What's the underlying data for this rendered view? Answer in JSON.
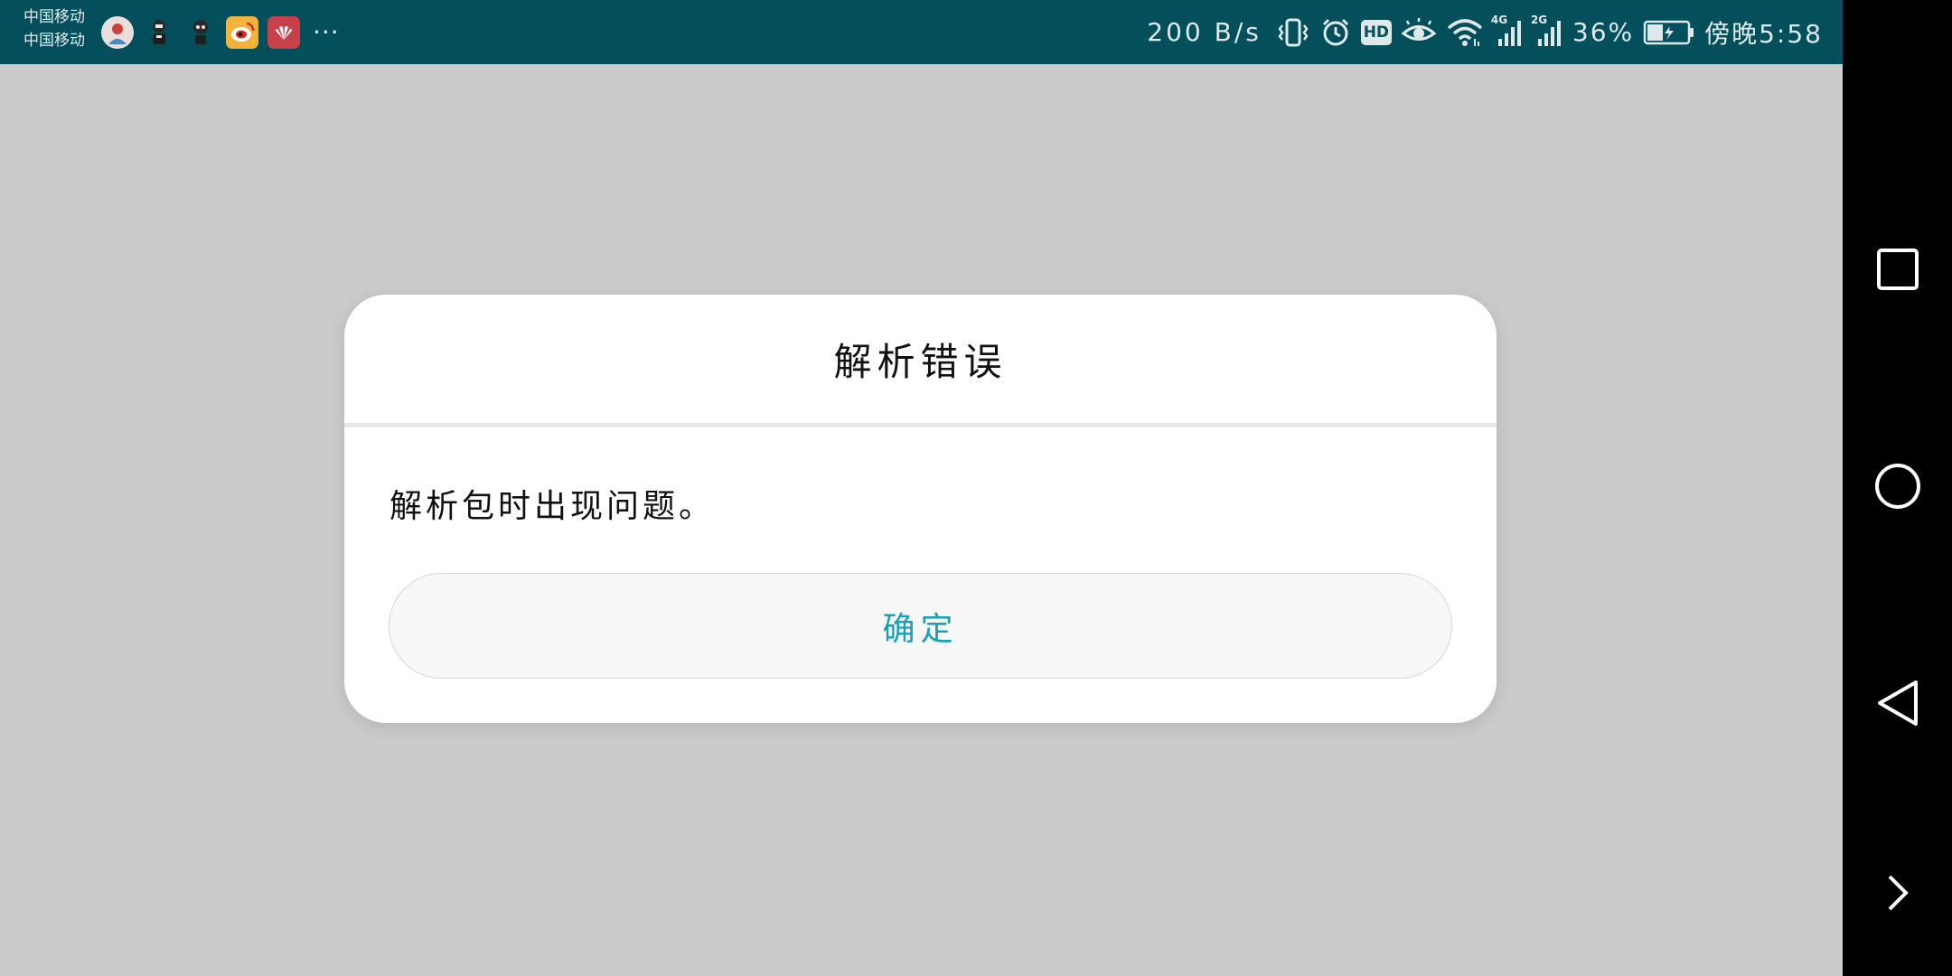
{
  "status_bar": {
    "carrier_1": "中国移动",
    "carrier_2": "中国移动",
    "more": "···",
    "network_speed": "200 B/s",
    "signal_1_type": "4G",
    "signal_2_type": "2G",
    "hd_label": "HD",
    "battery_percent": "36%",
    "time": "傍晚5:58",
    "notification_icons": [
      "contact-avatar-icon",
      "game-character-icon",
      "game-character-icon",
      "weibo-icon",
      "huawei-icon"
    ],
    "system_icons": [
      "vibrate-icon",
      "alarm-icon",
      "hd-icon",
      "eye-comfort-icon",
      "wifi-icon",
      "signal-icon",
      "signal-icon",
      "battery-charging-icon"
    ]
  },
  "dialog": {
    "title": "解析错误",
    "message": "解析包时出现问题。",
    "confirm_label": "确定"
  },
  "nav_bar": {
    "buttons": [
      "recents-icon",
      "home-icon",
      "back-icon",
      "expand-icon"
    ]
  },
  "colors": {
    "status_bar_bg": "#034f5c",
    "scrim_bg": "#cbcbcb",
    "dialog_bg": "#ffffff",
    "accent": "#16a1b8",
    "nav_bar_bg": "#000000"
  }
}
